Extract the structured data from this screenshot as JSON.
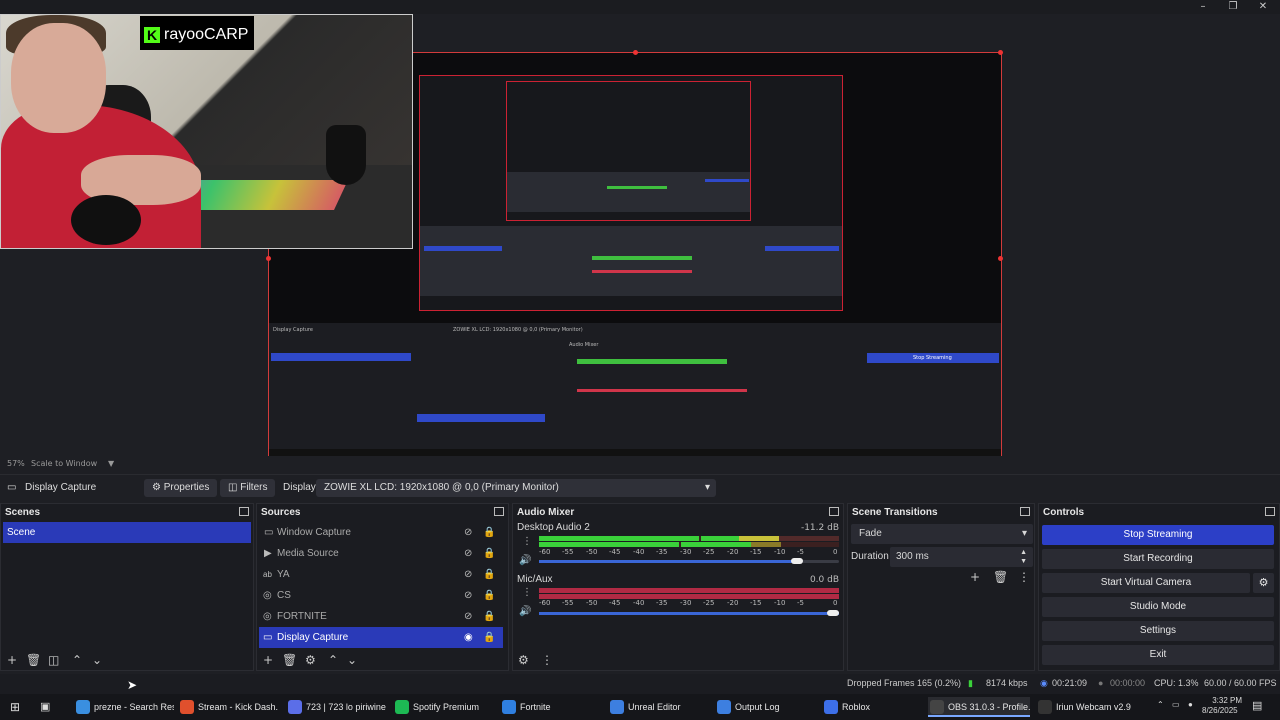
{
  "window": {
    "minimize": "–",
    "maximize": "❐",
    "close": "✕"
  },
  "webcam": {
    "channel_name": "rayooCARP",
    "kick_logo": "K"
  },
  "preview": {
    "zoom": "57%",
    "scale_mode": "Scale to Window"
  },
  "context_bar": {
    "source_name": "Display Capture",
    "properties_label": "Properties",
    "filters_label": "Filters",
    "display_label": "Display",
    "display_value": "ZOWIE XL LCD: 1920x1080 @ 0,0 (Primary Monitor)"
  },
  "scenes": {
    "title": "Scenes",
    "items": [
      "Scene"
    ]
  },
  "sources": {
    "title": "Sources",
    "items": [
      {
        "label": "Window Capture",
        "icon": "window-icon",
        "visible": false
      },
      {
        "label": "Media Source",
        "icon": "play-icon",
        "visible": false
      },
      {
        "label": "YA",
        "icon": "text-icon",
        "visible": false
      },
      {
        "label": "CS",
        "icon": "gamepad-icon",
        "visible": false
      },
      {
        "label": "FORTNITE",
        "icon": "gamepad-icon",
        "visible": false
      },
      {
        "label": "Display Capture",
        "icon": "monitor-icon",
        "visible": true
      }
    ]
  },
  "audio_mixer": {
    "title": "Audio Mixer",
    "channels": [
      {
        "name": "Desktop Audio 2",
        "db": "-11.2 dB",
        "volume": 0.86
      },
      {
        "name": "Mic/Aux",
        "db": "0.0 dB",
        "volume": 1.0
      }
    ],
    "scale": [
      "-60",
      "-55",
      "-50",
      "-45",
      "-40",
      "-35",
      "-30",
      "-25",
      "-20",
      "-15",
      "-10",
      "-5",
      "0"
    ]
  },
  "scene_transitions": {
    "title": "Scene Transitions",
    "transition": "Fade",
    "duration_label": "Duration",
    "duration_value": "300 ms"
  },
  "controls": {
    "title": "Controls",
    "buttons": [
      "Stop Streaming",
      "Start Recording",
      "Start Virtual Camera",
      "Studio Mode",
      "Settings",
      "Exit"
    ]
  },
  "status": {
    "dropped_frames": "Dropped Frames 165 (0.2%)",
    "bitrate": "8174 kbps",
    "stream_time": "00:21:09",
    "record_time": "00:00:00",
    "cpu": "CPU: 1.3%",
    "fps": "60.00 / 60.00 FPS"
  },
  "taskbar": {
    "items": [
      {
        "label": "prezne - Search Res...",
        "color": "#3a8fe0"
      },
      {
        "label": "Stream - Kick Dash...",
        "color": "#e0502d"
      },
      {
        "label": "723 | 723 lo piriwine...",
        "color": "#5b6ee8"
      },
      {
        "label": "Spotify Premium",
        "color": "#1db954"
      },
      {
        "label": "Fortnite",
        "color": "#2f7fe0"
      },
      {
        "label": "Unreal Editor",
        "color": "#3d7fe0"
      },
      {
        "label": "Output Log",
        "color": "#3d7fe0"
      },
      {
        "label": "Roblox",
        "color": "#3d6fe8"
      },
      {
        "label": "OBS 31.0.3 - Profile...",
        "color": "#444"
      },
      {
        "label": "Iriun Webcam v2.9",
        "color": "#333"
      }
    ],
    "time": "3:32 PM",
    "date": "8/26/2025"
  }
}
